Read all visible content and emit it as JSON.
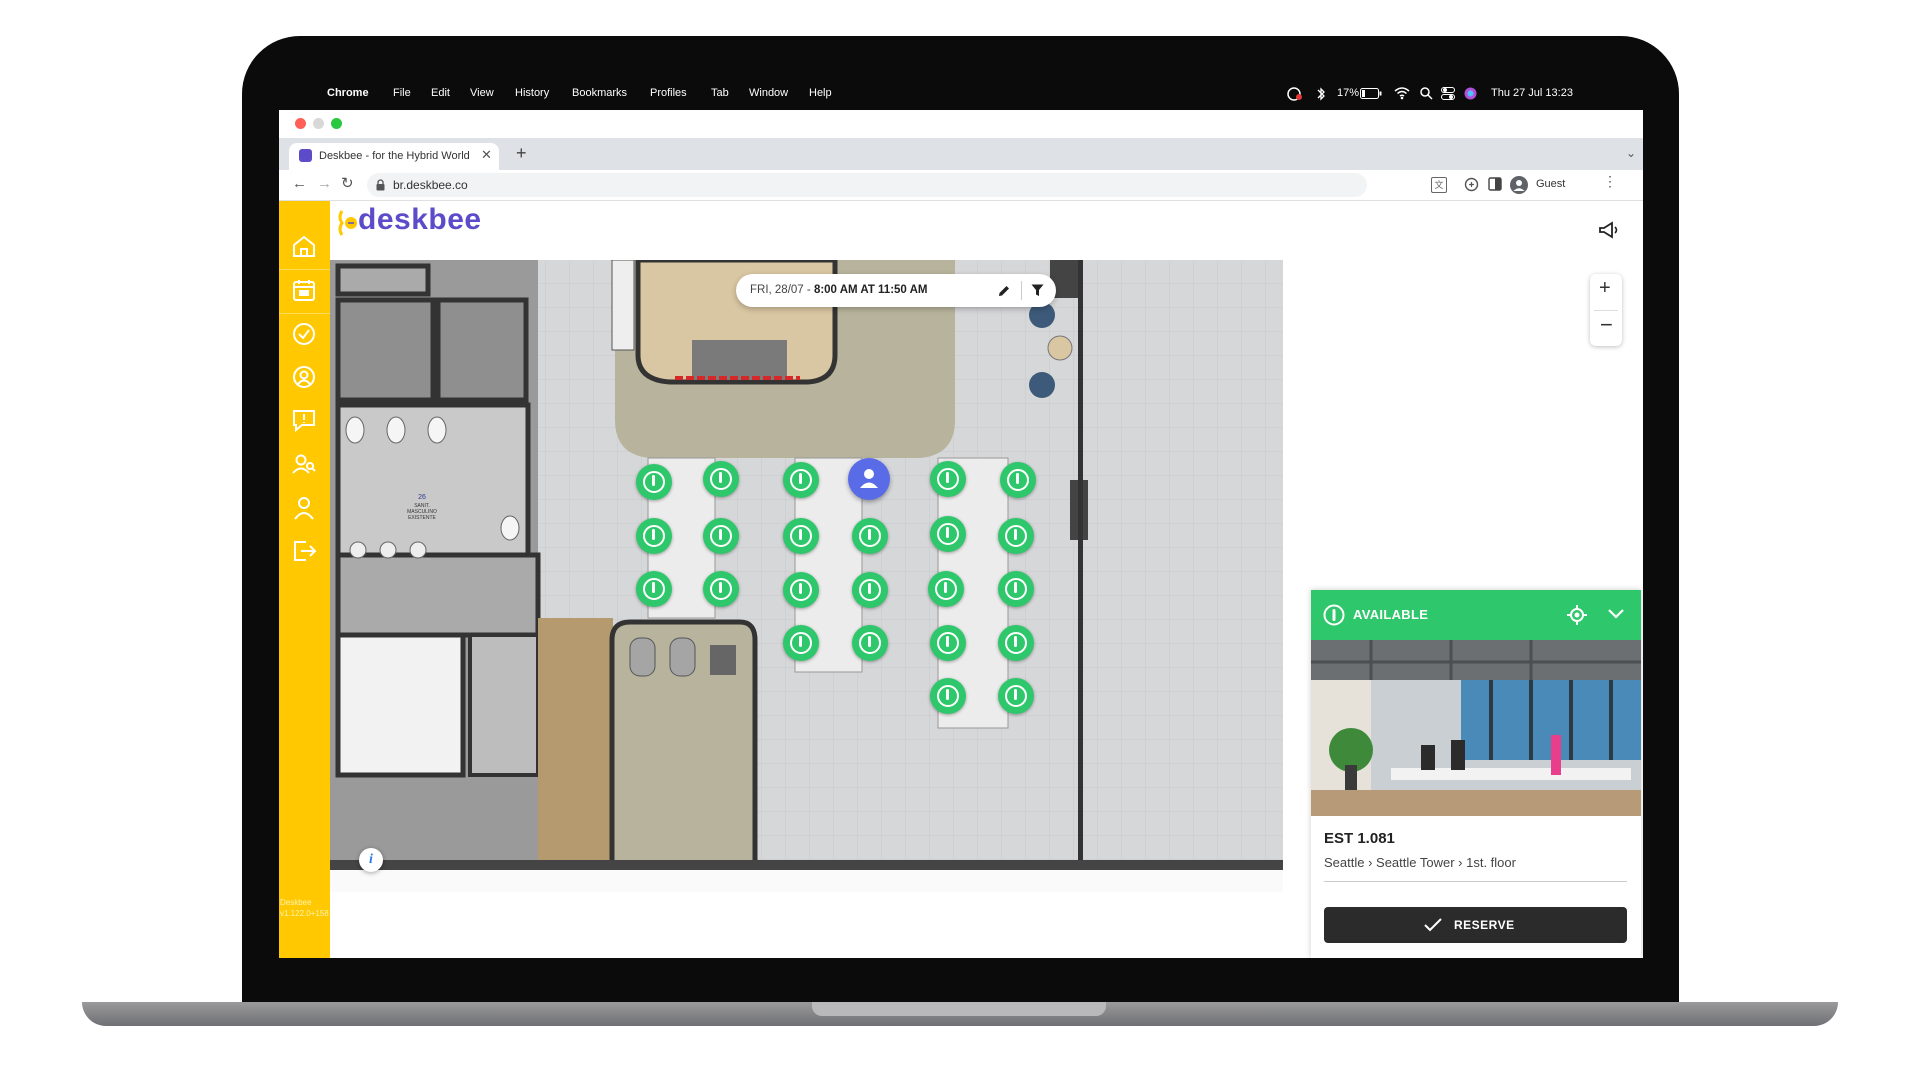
{
  "menubar": {
    "app_name": "Chrome",
    "items": [
      "File",
      "Edit",
      "View",
      "History",
      "Bookmarks",
      "Profiles",
      "Tab",
      "Window",
      "Help"
    ],
    "battery": "17%",
    "datetime": "Thu 27 Jul  13:23"
  },
  "browser": {
    "tab_title": "Deskbee - for the Hybrid World",
    "url": "br.deskbee.co",
    "profile": "Guest"
  },
  "app": {
    "brand": "deskbee",
    "version_line1": "Deskbee",
    "version_line2": "v1.122.0+158",
    "sidebar_icons": [
      "home-icon",
      "calendar-icon",
      "check-circle-icon",
      "location-user-icon",
      "alert-chat-icon",
      "people-search-icon",
      "user-icon",
      "logout-icon"
    ]
  },
  "schedule": {
    "date": "FRI, 28/07",
    "separator": " - ",
    "time": "8:00 AM AT 11:50 AM"
  },
  "map": {
    "room_number": "26",
    "room_label_1": "SANIT.",
    "room_label_2": "MASCULINO",
    "room_label_3": "EXISTENTE"
  },
  "panel": {
    "status": "AVAILABLE",
    "desk_code": "EST 1.081",
    "location": "Seattle › Seattle Tower › 1st. floor",
    "reserve_label": "RESERVE"
  },
  "colors": {
    "sidebar": "#ffc800",
    "available": "#2fc76b",
    "occupied": "#5a6be8",
    "brand_text": "#5d4cc9"
  }
}
